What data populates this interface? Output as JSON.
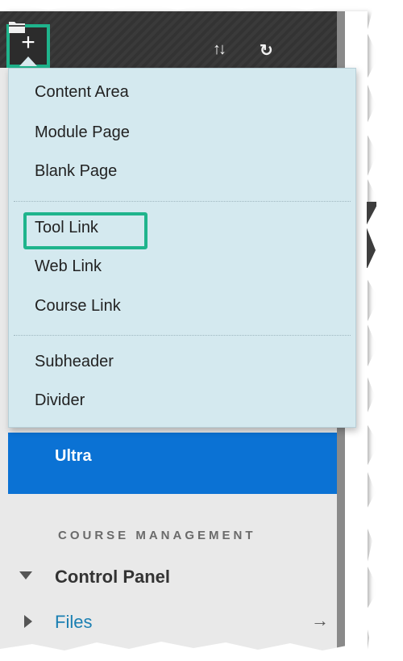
{
  "toolbar": {
    "add_glyph": "+",
    "reorder_glyph": "↑↓",
    "refresh_glyph": "↻"
  },
  "menu": {
    "items": [
      {
        "label": "Content Area"
      },
      {
        "label": "Module Page"
      },
      {
        "label": "Blank Page"
      },
      {
        "label": "Tool Link"
      },
      {
        "label": "Web Link"
      },
      {
        "label": "Course Link"
      },
      {
        "label": "Subheader"
      },
      {
        "label": "Divider"
      }
    ]
  },
  "course_menu": {
    "ultra_label": "Ultra",
    "section_header": "COURSE MANAGEMENT",
    "control_panel_label": "Control Panel",
    "files_label": "Files",
    "files_arrow": "→"
  },
  "colors": {
    "highlight": "#1fb48c",
    "menu_bg": "#d4e9ef",
    "ultra_blue": "#0b72d4",
    "link": "#1a7fb2"
  }
}
